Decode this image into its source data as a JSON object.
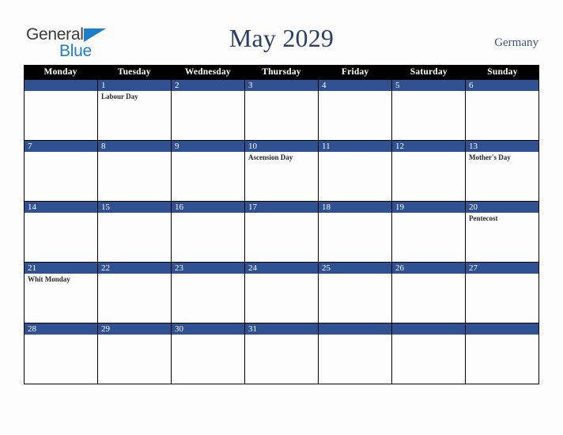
{
  "brand": {
    "name_part1": "General",
    "name_part2": "Blue",
    "triangle_icon": "triangle-icon",
    "color_dark": "#3a3a3a",
    "color_blue": "#1e7ec8"
  },
  "header": {
    "title": "May 2029",
    "country": "Germany",
    "title_color": "#2b3f63"
  },
  "calendar": {
    "accent_color": "#2f5191",
    "header_bg": "#000000",
    "weekdays": [
      "Monday",
      "Tuesday",
      "Wednesday",
      "Thursday",
      "Friday",
      "Saturday",
      "Sunday"
    ],
    "weeks": [
      [
        {
          "date": "",
          "event": ""
        },
        {
          "date": "1",
          "event": "Labour Day"
        },
        {
          "date": "2",
          "event": ""
        },
        {
          "date": "3",
          "event": ""
        },
        {
          "date": "4",
          "event": ""
        },
        {
          "date": "5",
          "event": ""
        },
        {
          "date": "6",
          "event": ""
        }
      ],
      [
        {
          "date": "7",
          "event": ""
        },
        {
          "date": "8",
          "event": ""
        },
        {
          "date": "9",
          "event": ""
        },
        {
          "date": "10",
          "event": "Ascension Day"
        },
        {
          "date": "11",
          "event": ""
        },
        {
          "date": "12",
          "event": ""
        },
        {
          "date": "13",
          "event": "Mother's Day"
        }
      ],
      [
        {
          "date": "14",
          "event": ""
        },
        {
          "date": "15",
          "event": ""
        },
        {
          "date": "16",
          "event": ""
        },
        {
          "date": "17",
          "event": ""
        },
        {
          "date": "18",
          "event": ""
        },
        {
          "date": "19",
          "event": ""
        },
        {
          "date": "20",
          "event": "Pentecost"
        }
      ],
      [
        {
          "date": "21",
          "event": "Whit Monday"
        },
        {
          "date": "22",
          "event": ""
        },
        {
          "date": "23",
          "event": ""
        },
        {
          "date": "24",
          "event": ""
        },
        {
          "date": "25",
          "event": ""
        },
        {
          "date": "26",
          "event": ""
        },
        {
          "date": "27",
          "event": ""
        }
      ],
      [
        {
          "date": "28",
          "event": ""
        },
        {
          "date": "29",
          "event": ""
        },
        {
          "date": "30",
          "event": ""
        },
        {
          "date": "31",
          "event": ""
        },
        {
          "date": "",
          "event": ""
        },
        {
          "date": "",
          "event": ""
        },
        {
          "date": "",
          "event": ""
        }
      ]
    ]
  }
}
